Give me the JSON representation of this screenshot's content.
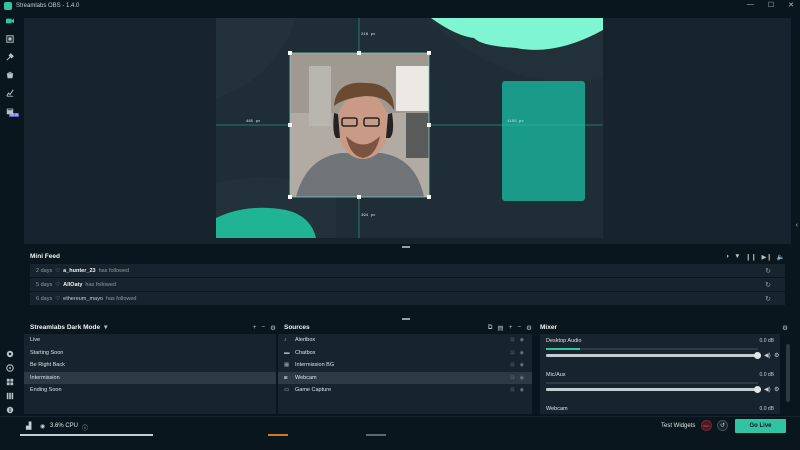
{
  "app": {
    "title": "Streamlabs OBS - 1.4.0"
  },
  "window_controls": {
    "minimize": "—",
    "maximize": "☐",
    "close": "✕"
  },
  "nav": {
    "items": [
      "studio-icon",
      "themes-icon",
      "tools-icon",
      "store-icon",
      "stats-icon",
      "alertbox-library-icon"
    ],
    "new_badge": "NEW",
    "bottom_items": [
      "dashboard-icon",
      "help-icon",
      "layout-icon",
      "grid-icon",
      "info-icon",
      "settings-icon"
    ]
  },
  "canvas": {
    "measurements": {
      "top": "216 px",
      "left": "485 px",
      "right": "1155 px",
      "bottom": "394 px"
    },
    "accent": "#31c3a2",
    "panel_color": "#1a9a89"
  },
  "mini_feed": {
    "title": "Mini Feed",
    "tools": [
      "shield-icon",
      "filter-icon",
      "pause-icon",
      "skip-icon",
      "volume-icon"
    ],
    "events": [
      {
        "ago": "2 days",
        "user": "a_hunter_23",
        "action": "has followed"
      },
      {
        "ago": "5 days",
        "user": "AllOaty",
        "action": "has followed"
      },
      {
        "ago": "6 days",
        "user": "ethereum_mayo",
        "action": "has followed"
      }
    ]
  },
  "scenes": {
    "title": "Streamlabs Dark Mode",
    "dropdown": "▾",
    "items": [
      "Live",
      "Starting Soon",
      "Be Right Back",
      "Intermission",
      "Ending Soon"
    ],
    "active": 3
  },
  "sources": {
    "title": "Sources",
    "items": [
      {
        "name": "Alertbox",
        "icon": "bell-icon"
      },
      {
        "name": "Chatbox",
        "icon": "chat-icon"
      },
      {
        "name": "Intermission BG",
        "icon": "image-icon"
      },
      {
        "name": "Webcam",
        "icon": "camera-icon"
      },
      {
        "name": "Game Capture",
        "icon": "gamepad-icon"
      }
    ],
    "active": 3
  },
  "mixer": {
    "title": "Mixer",
    "items": [
      {
        "name": "Desktop Audio",
        "db": "0.0 dB",
        "level": 0.16,
        "volume": 1.0
      },
      {
        "name": "Mic/Aux",
        "db": "0.0 dB",
        "level": 0.0,
        "volume": 1.0
      },
      {
        "name": "Webcam",
        "db": "0.0 dB",
        "level": 0.0,
        "volume": 1.0
      }
    ]
  },
  "status": {
    "cpu": "3.6% CPU",
    "test_widgets": "Test Widgets",
    "rec": "REC",
    "go_live": "Go Live"
  },
  "colors": {
    "bg": "#09161d",
    "panel": "#17242d",
    "teal": "#31c3a2",
    "mint": "#80f5d2"
  }
}
